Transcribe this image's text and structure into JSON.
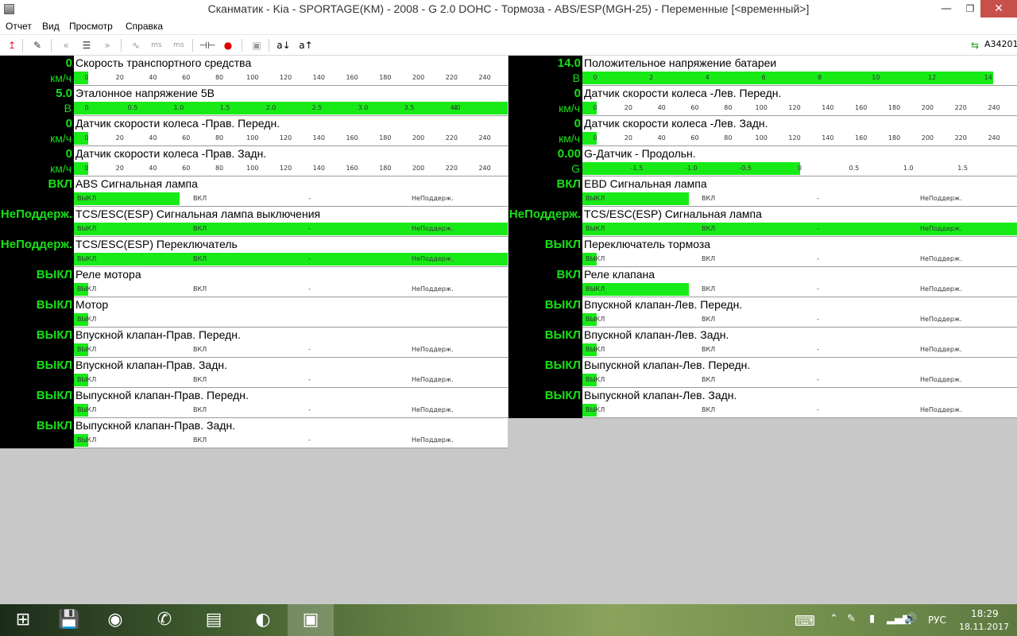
{
  "window": {
    "title": "Сканматик - Kia - SPORTAGE(KM) - 2008 - G 2.0 DOHC - Тормоза - ABS/ESP(MGH-25) - Переменные [<временный>]",
    "min_glyph": "—",
    "max_glyph": "❐",
    "close_glyph": "✕"
  },
  "menu": [
    "Отчет",
    "Вид",
    "Просмотр",
    "Справка"
  ],
  "toolbar": {
    "buttons": [
      {
        "icon": "exit-arrow-icon",
        "glyph": "↥",
        "color": "#e02020"
      },
      {
        "icon": "report-edit-icon",
        "glyph": "✎",
        "color": "#333333"
      },
      {
        "icon": "rewind-icon",
        "glyph": "«",
        "color": "#999999"
      },
      {
        "icon": "list-icon",
        "glyph": "☰",
        "color": "#333333"
      },
      {
        "icon": "forward-icon",
        "glyph": "»",
        "color": "#999999"
      },
      {
        "icon": "wave-icon",
        "glyph": "∿",
        "color": "#999999"
      },
      {
        "icon": "ms-minus-icon",
        "glyph": "ms",
        "color": "#999999"
      },
      {
        "icon": "ms-plus-icon",
        "glyph": "ms",
        "color": "#999999"
      },
      {
        "icon": "probe-icon",
        "glyph": "⊣⊢",
        "color": "#333333"
      },
      {
        "icon": "record-icon",
        "glyph": "●",
        "color": "#e00000"
      },
      {
        "icon": "save-icon",
        "glyph": "▣",
        "color": "#999999"
      },
      {
        "icon": "sort-asc-icon",
        "glyph": "a↓",
        "color": "#000000"
      },
      {
        "icon": "sort-desc-icon",
        "glyph": "a↑",
        "color": "#000000"
      }
    ],
    "device_icon": "usb-icon",
    "device_id": "A34201"
  },
  "state_ticks": [
    "ВЫКЛ",
    "ВКЛ",
    "-",
    "НеПоддерж."
  ],
  "state_ticks_short": [
    "ВЫКЛ"
  ],
  "left_params": [
    {
      "value": "0",
      "unit": "км/ч",
      "name": "Скорость транспортного средства",
      "type": "scale",
      "ticks": [
        "0",
        "20",
        "40",
        "60",
        "80",
        "100",
        "120",
        "140",
        "160",
        "180",
        "200",
        "220",
        "240"
      ],
      "min": 0,
      "max": 250,
      "level": 0
    },
    {
      "value": "5.0",
      "unit": "В",
      "name": "Эталонное напряжение 5В",
      "type": "scale",
      "ticks": [
        "0",
        "0.5",
        "1.0",
        "1.5",
        "2.0",
        "2.5",
        "3.0",
        "3.5",
        "4.0",
        "4"
      ],
      "min": 0,
      "max": 4.5,
      "level": 5.0
    },
    {
      "value": "0",
      "unit": "км/ч",
      "name": "Датчик скорости колеса -Прав. Передн.",
      "type": "scale",
      "ticks": [
        "0",
        "20",
        "40",
        "60",
        "80",
        "100",
        "120",
        "140",
        "160",
        "180",
        "200",
        "220",
        "240"
      ],
      "min": 0,
      "max": 250,
      "level": 0
    },
    {
      "value": "0",
      "unit": "км/ч",
      "name": "Датчик скорости колеса -Прав. Задн.",
      "type": "scale",
      "ticks": [
        "0",
        "20",
        "40",
        "60",
        "80",
        "100",
        "120",
        "140",
        "160",
        "180",
        "200",
        "220",
        "240"
      ],
      "min": 0,
      "max": 250,
      "level": 0
    },
    {
      "value": "ВКЛ",
      "unit": "",
      "name": "ABS Сигнальная лампа",
      "type": "state",
      "state_index": 1
    },
    {
      "value": "НеПоддерж.",
      "unit": "",
      "name": "TCS/ESC(ESP) Сигнальная лампа выключения",
      "type": "state",
      "state_index": 3
    },
    {
      "value": "НеПоддерж.",
      "unit": "",
      "name": "TCS/ESC(ESP) Переключатель",
      "type": "state",
      "state_index": 3
    },
    {
      "value": "ВЫКЛ",
      "unit": "",
      "name": "Реле мотора",
      "type": "state",
      "state_index": 0
    },
    {
      "value": "ВЫКЛ",
      "unit": "",
      "name": "Мотор",
      "type": "state",
      "state_index": 0,
      "short": true
    },
    {
      "value": "ВЫКЛ",
      "unit": "",
      "name": "Впускной клапан-Прав. Передн.",
      "type": "state",
      "state_index": 0
    },
    {
      "value": "ВЫКЛ",
      "unit": "",
      "name": "Впускной клапан-Прав. Задн.",
      "type": "state",
      "state_index": 0
    },
    {
      "value": "ВЫКЛ",
      "unit": "",
      "name": "Выпускной клапан-Прав. Передн.",
      "type": "state",
      "state_index": 0
    },
    {
      "value": "ВЫКЛ",
      "unit": "",
      "name": "Выпускной клапан-Прав. Задн.",
      "type": "state",
      "state_index": 0
    }
  ],
  "right_params": [
    {
      "value": "14.0",
      "unit": "В",
      "name": "Положительное напряжение батареи",
      "type": "scale",
      "ticks": [
        "0",
        "2",
        "4",
        "6",
        "8",
        "10",
        "12",
        "14"
      ],
      "min": 0,
      "max": 14.8,
      "level": 14.0
    },
    {
      "value": "0",
      "unit": "км/ч",
      "name": "Датчик скорости колеса -Лев. Передн.",
      "type": "scale",
      "ticks": [
        "0",
        "20",
        "40",
        "60",
        "80",
        "100",
        "120",
        "140",
        "160",
        "180",
        "200",
        "220",
        "240"
      ],
      "min": 0,
      "max": 250,
      "level": 0
    },
    {
      "value": "0",
      "unit": "км/ч",
      "name": "Датчик скорости колеса -Лев. Задн.",
      "type": "scale",
      "ticks": [
        "0",
        "20",
        "40",
        "60",
        "80",
        "100",
        "120",
        "140",
        "160",
        "180",
        "200",
        "220",
        "240"
      ],
      "min": 0,
      "max": 250,
      "level": 0
    },
    {
      "value": "0.00",
      "unit": "G",
      "name": "G-Датчик - Продольн.",
      "type": "scale",
      "ticks": [
        "-1.5",
        "-1.0",
        "-0.5",
        "0",
        "0.5",
        "1.0",
        "1.5"
      ],
      "min": -2.0,
      "max": 2.0,
      "level": 0.0
    },
    {
      "value": "ВКЛ",
      "unit": "",
      "name": "EBD Сигнальная лампа",
      "type": "state",
      "state_index": 1
    },
    {
      "value": "НеПоддерж.",
      "unit": "",
      "name": "TCS/ESC(ESP) Сигнальная лампа",
      "type": "state",
      "state_index": 3
    },
    {
      "value": "ВЫКЛ",
      "unit": "",
      "name": "Переключатель тормоза",
      "type": "state",
      "state_index": 0
    },
    {
      "value": "ВКЛ",
      "unit": "",
      "name": "Реле клапана",
      "type": "state",
      "state_index": 1
    },
    {
      "value": "ВЫКЛ",
      "unit": "",
      "name": "Впускной клапан-Лев. Передн.",
      "type": "state",
      "state_index": 0
    },
    {
      "value": "ВЫКЛ",
      "unit": "",
      "name": "Впускной клапан-Лев. Задн.",
      "type": "state",
      "state_index": 0
    },
    {
      "value": "ВЫКЛ",
      "unit": "",
      "name": "Выпускной клапан-Лев. Передн.",
      "type": "state",
      "state_index": 0
    },
    {
      "value": "ВЫКЛ",
      "unit": "",
      "name": "Выпускной клапан-Лев. Задн.",
      "type": "state",
      "state_index": 0
    }
  ],
  "taskbar": {
    "apps": [
      {
        "icon": "windows-start-icon",
        "active": false
      },
      {
        "icon": "save-app-icon",
        "active": false
      },
      {
        "icon": "chrome-icon",
        "active": false
      },
      {
        "icon": "viber-icon",
        "active": false
      },
      {
        "icon": "control-panel-icon",
        "active": false
      },
      {
        "icon": "browser-icon",
        "active": false
      },
      {
        "icon": "scanmatic-icon",
        "active": true
      }
    ],
    "tray_icons": [
      "keyboard-icon",
      "chevron-up-icon",
      "pen-icon",
      "battery-icon",
      "signal-icon",
      "volume-icon"
    ],
    "language": "РУС",
    "time": "18:29",
    "date": "18.11.2017"
  }
}
